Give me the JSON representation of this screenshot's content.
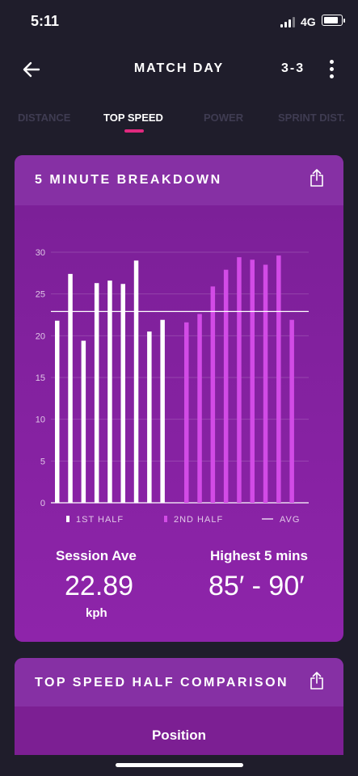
{
  "status": {
    "time": "5:11",
    "network": "4G"
  },
  "nav": {
    "title": "MATCH DAY",
    "score": "3-3"
  },
  "tabs": [
    "DISTANCE",
    "TOP SPEED",
    "POWER",
    "SPRINT DIST."
  ],
  "active_tab": "TOP SPEED",
  "breakdown": {
    "title": "5 MINUTE BREAKDOWN",
    "session_label": "Session Ave",
    "session_value": "22.89",
    "session_unit": "kph",
    "highest_label": "Highest 5 mins",
    "highest_value": "85′ - 90′"
  },
  "comparison": {
    "title": "TOP SPEED HALF COMPARISON",
    "position_label": "Position"
  },
  "colors": {
    "first_half": "#ffffff",
    "second_half": "#d24be6",
    "accent": "#e0297e"
  },
  "chart_data": {
    "type": "bar",
    "ylim": [
      0,
      30
    ],
    "yticks": [
      0,
      5,
      10,
      15,
      20,
      25,
      30
    ],
    "avg": 22.9,
    "legend": [
      "1ST HALF",
      "2ND HALF",
      "AVG"
    ],
    "series": [
      {
        "name": "1ST HALF",
        "values": [
          21.8,
          27.4,
          19.4,
          26.3,
          26.6,
          26.2,
          29.0,
          20.5,
          21.9
        ]
      },
      {
        "name": "2ND HALF",
        "values": [
          21.6,
          22.6,
          25.9,
          27.9,
          29.4,
          29.1,
          28.5,
          29.6,
          21.9
        ]
      }
    ]
  }
}
